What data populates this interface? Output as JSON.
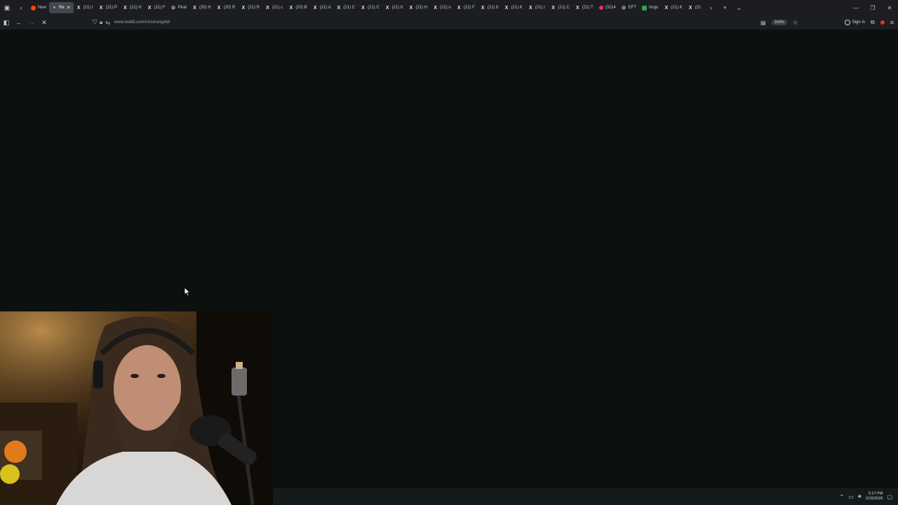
{
  "tabs": [
    {
      "label": "New",
      "favicon": "reddit-icon",
      "active": false
    },
    {
      "label": "Re",
      "favicon": "loading-icon",
      "active": true
    },
    {
      "label": "(21) I",
      "favicon": "x-icon"
    },
    {
      "label": "(21) P",
      "favicon": "x-icon"
    },
    {
      "label": "(21) H",
      "favicon": "x-icon"
    },
    {
      "label": "(21) F",
      "favicon": "x-icon"
    },
    {
      "label": "Pirat",
      "favicon": "generic-icon"
    },
    {
      "label": "(20) H",
      "favicon": "x-icon"
    },
    {
      "label": "(20) R",
      "favicon": "x-icon"
    },
    {
      "label": "(21) R",
      "favicon": "x-icon"
    },
    {
      "label": "(21) c",
      "favicon": "x-icon"
    },
    {
      "label": "(20) B",
      "favicon": "x-icon"
    },
    {
      "label": "(21) d",
      "favicon": "x-icon"
    },
    {
      "label": "(21) C",
      "favicon": "x-icon"
    },
    {
      "label": "(21) C",
      "favicon": "x-icon"
    },
    {
      "label": "(21) b",
      "favicon": "x-icon"
    },
    {
      "label": "(21) H",
      "favicon": "x-icon"
    },
    {
      "label": "(21) n",
      "favicon": "x-icon"
    },
    {
      "label": "(21) F",
      "favicon": "x-icon"
    },
    {
      "label": "(21) b",
      "favicon": "x-icon"
    },
    {
      "label": "(21) K",
      "favicon": "x-icon"
    },
    {
      "label": "(21) r",
      "favicon": "x-icon"
    },
    {
      "label": "(21) C",
      "favicon": "x-icon"
    },
    {
      "label": "(21) T",
      "favicon": "x-icon"
    },
    {
      "label": "(3114",
      "favicon": "red-dot-icon"
    },
    {
      "label": "EFT",
      "favicon": "generic-icon"
    },
    {
      "label": "Imgu",
      "favicon": "green-icon"
    },
    {
      "label": "(21) K",
      "favicon": "x-icon"
    },
    {
      "label": "(21",
      "favicon": "x-icon"
    }
  ],
  "nav": {
    "url_host": "www.reddit.com",
    "url_path": "/r/Asmongold/",
    "zoom": "150%",
    "signin_label": "Sign in"
  },
  "taskbar": {
    "time": "5:17 PM",
    "date": "2/15/2026"
  },
  "colors": {
    "page_bg": "#0c1110",
    "chrome_bg": "#1b1d20",
    "taskbar_bg": "#151b1d"
  }
}
